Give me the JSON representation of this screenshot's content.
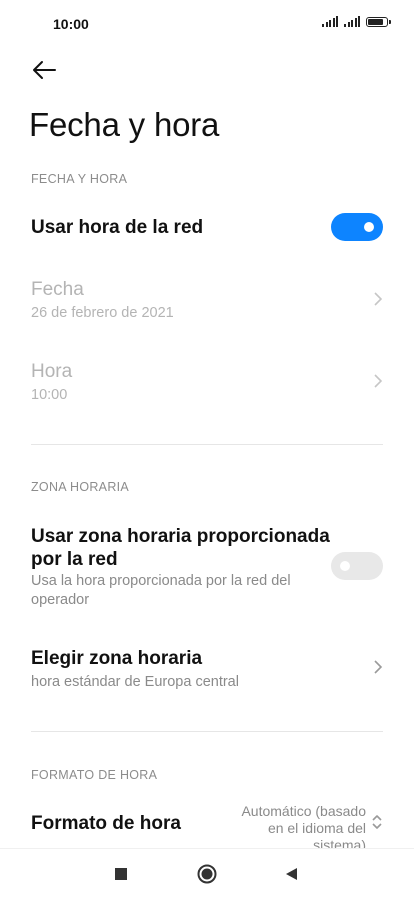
{
  "status_bar": {
    "time": "10:00"
  },
  "page": {
    "title": "Fecha y hora"
  },
  "sections": {
    "date_time": {
      "header": "FECHA Y HORA",
      "network_time": {
        "label": "Usar hora de la red",
        "enabled": true
      },
      "date": {
        "label": "Fecha",
        "value": "26 de febrero de 2021"
      },
      "time": {
        "label": "Hora",
        "value": "10:00"
      }
    },
    "time_zone": {
      "header": "ZONA HORARIA",
      "network_zone": {
        "label_line1": "Usar zona horaria proporcionada",
        "label_line2": "por la red",
        "desc_line1": "Usa la hora proporcionada por la red del",
        "desc_line2": "operador",
        "enabled": false
      },
      "choose_zone": {
        "label": "Elegir zona horaria",
        "value": "hora estándar de Europa central"
      }
    },
    "format": {
      "header": "FORMATO DE HORA",
      "time_format": {
        "label": "Formato de hora",
        "value_line1": "Automático (basado",
        "value_line2": "en el idioma del",
        "value_line3": "sistema)"
      }
    }
  },
  "colors": {
    "accent": "#0d84ff",
    "disabled_text": "#b4b4b4",
    "secondary_text": "#8a8a8a"
  }
}
